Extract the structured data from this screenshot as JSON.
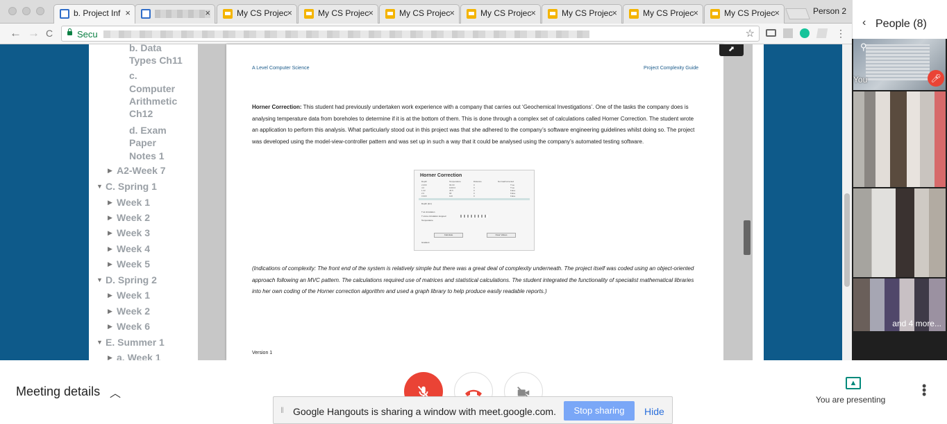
{
  "browser": {
    "tabs": [
      {
        "title": "b. Project Inf",
        "type": "doc",
        "active": true
      },
      {
        "title": "",
        "type": "doc",
        "blurred": true
      },
      {
        "title": "My CS Projec",
        "type": "slides"
      },
      {
        "title": "My CS Projec",
        "type": "slides"
      },
      {
        "title": "My CS Projec",
        "type": "slides"
      },
      {
        "title": "My CS Projec",
        "type": "slides"
      },
      {
        "title": "My CS Projec",
        "type": "slides"
      },
      {
        "title": "My CS Projec",
        "type": "slides"
      },
      {
        "title": "My CS Projec",
        "type": "slides"
      }
    ],
    "close_glyph": "×",
    "profile": "Person 2",
    "address": {
      "secure_label": "Secu",
      "url_blurred": true
    },
    "nav": {
      "back": "←",
      "forward": "→",
      "reload": "C",
      "star": "☆"
    }
  },
  "doc_sidebar": {
    "items": [
      {
        "text": "b. Data",
        "indent": 2
      },
      {
        "text": "Types Ch11",
        "indent": 2
      },
      {
        "text": "c.",
        "indent": 2
      },
      {
        "text": "Computer",
        "indent": 2
      },
      {
        "text": "Arithmetic",
        "indent": 2
      },
      {
        "text": "Ch12",
        "indent": 2
      },
      {
        "text": "d. Exam",
        "indent": 2
      },
      {
        "text": "Paper",
        "indent": 2
      },
      {
        "text": "Notes 1",
        "indent": 2
      },
      {
        "text": "A2-Week 7",
        "indent": 1,
        "arrow": "right"
      },
      {
        "text": "C. Spring 1",
        "indent": 0,
        "arrow": "down"
      },
      {
        "text": "Week 1",
        "indent": 1,
        "arrow": "right"
      },
      {
        "text": "Week 2",
        "indent": 1,
        "arrow": "right"
      },
      {
        "text": "Week 3",
        "indent": 1,
        "arrow": "right"
      },
      {
        "text": "Week 4",
        "indent": 1,
        "arrow": "right"
      },
      {
        "text": "Week 5",
        "indent": 1,
        "arrow": "right"
      },
      {
        "text": "D. Spring 2",
        "indent": 0,
        "arrow": "down"
      },
      {
        "text": "Week 1",
        "indent": 1,
        "arrow": "right"
      },
      {
        "text": "Week 2",
        "indent": 1,
        "arrow": "right"
      },
      {
        "text": "Week 6",
        "indent": 1,
        "arrow": "right"
      },
      {
        "text": "E. Summer 1",
        "indent": 0,
        "arrow": "down"
      },
      {
        "text": "a. Week 1",
        "indent": 1,
        "arrow": "right"
      }
    ]
  },
  "document": {
    "header_left": "A Level Computer Science",
    "header_right": "Project Complexity Guide",
    "para1_heading": "Horner Correction:",
    "para1_body": "This student had previously undertaken work experience with a company that carries out ‘Geochemical Investigations’. One of the tasks the company does is analysing temperature data from boreholes to determine if it is at the bottom of them. This is done through a complex set of calculations called Horner Correction. The student wrote an application to perform this analysis. What particularly stood out in this project was that she adhered to the company’s software engineering guidelines whilst doing so. The project was developed using the model-view-controller pattern and was set up in such a way that it could be analysed using the company’s automated testing software.",
    "screenshot": {
      "title": "Horner Correction",
      "columns": [
        "Depth",
        "Temperature",
        "Distance",
        "Normal/corrected"
      ],
      "rows": [
        [
          "2,000",
          "99.00",
          "0",
          "True"
        ],
        [
          "4.0",
          "1000.0",
          "0",
          "True"
        ],
        [
          "1.22",
          "46.5",
          "0",
          "False"
        ],
        [
          "2.0",
          "68",
          "0",
          "False"
        ],
        [
          "0.900",
          "120",
          "0",
          "False"
        ]
      ],
      "labels": [
        "Depth (km)",
        "T at circulation",
        "T since circulation stopped",
        "Temperature"
      ],
      "buttons": [
        "Calculate",
        "Clear Values"
      ],
      "footer": "Gradient"
    },
    "para2": "(Indications of complexity: The front end of the system is relatively simple but there was a great deal of complexity underneath. The project itself was coded using an object-oriented approach following an MVC pattern. The calculations required use of matrices and statistical calculations. The student integrated the functionality of specialist mathematical libraries into her own coding of the Horner correction algorithm and used a graph library to help produce easily readable reports.)",
    "footer": "Version 1"
  },
  "people_panel": {
    "title": "People (8)",
    "back_glyph": "‹",
    "you_label": "You",
    "more_label": "and 4 more..."
  },
  "controls": {
    "meeting_details": "Meeting details",
    "chevron": "︿",
    "presenting": "You are presenting",
    "mic_state": "muted",
    "camera_state": "off"
  },
  "share_bar": {
    "message": "Google Hangouts is sharing a window with meet.google.com.",
    "stop_label": "Stop sharing",
    "hide_label": "Hide"
  },
  "colors": {
    "accent_red": "#ea4335",
    "present_teal": "#00897b",
    "stop_blue": "#7aa7f7",
    "link_blue": "#2a6fdb"
  }
}
